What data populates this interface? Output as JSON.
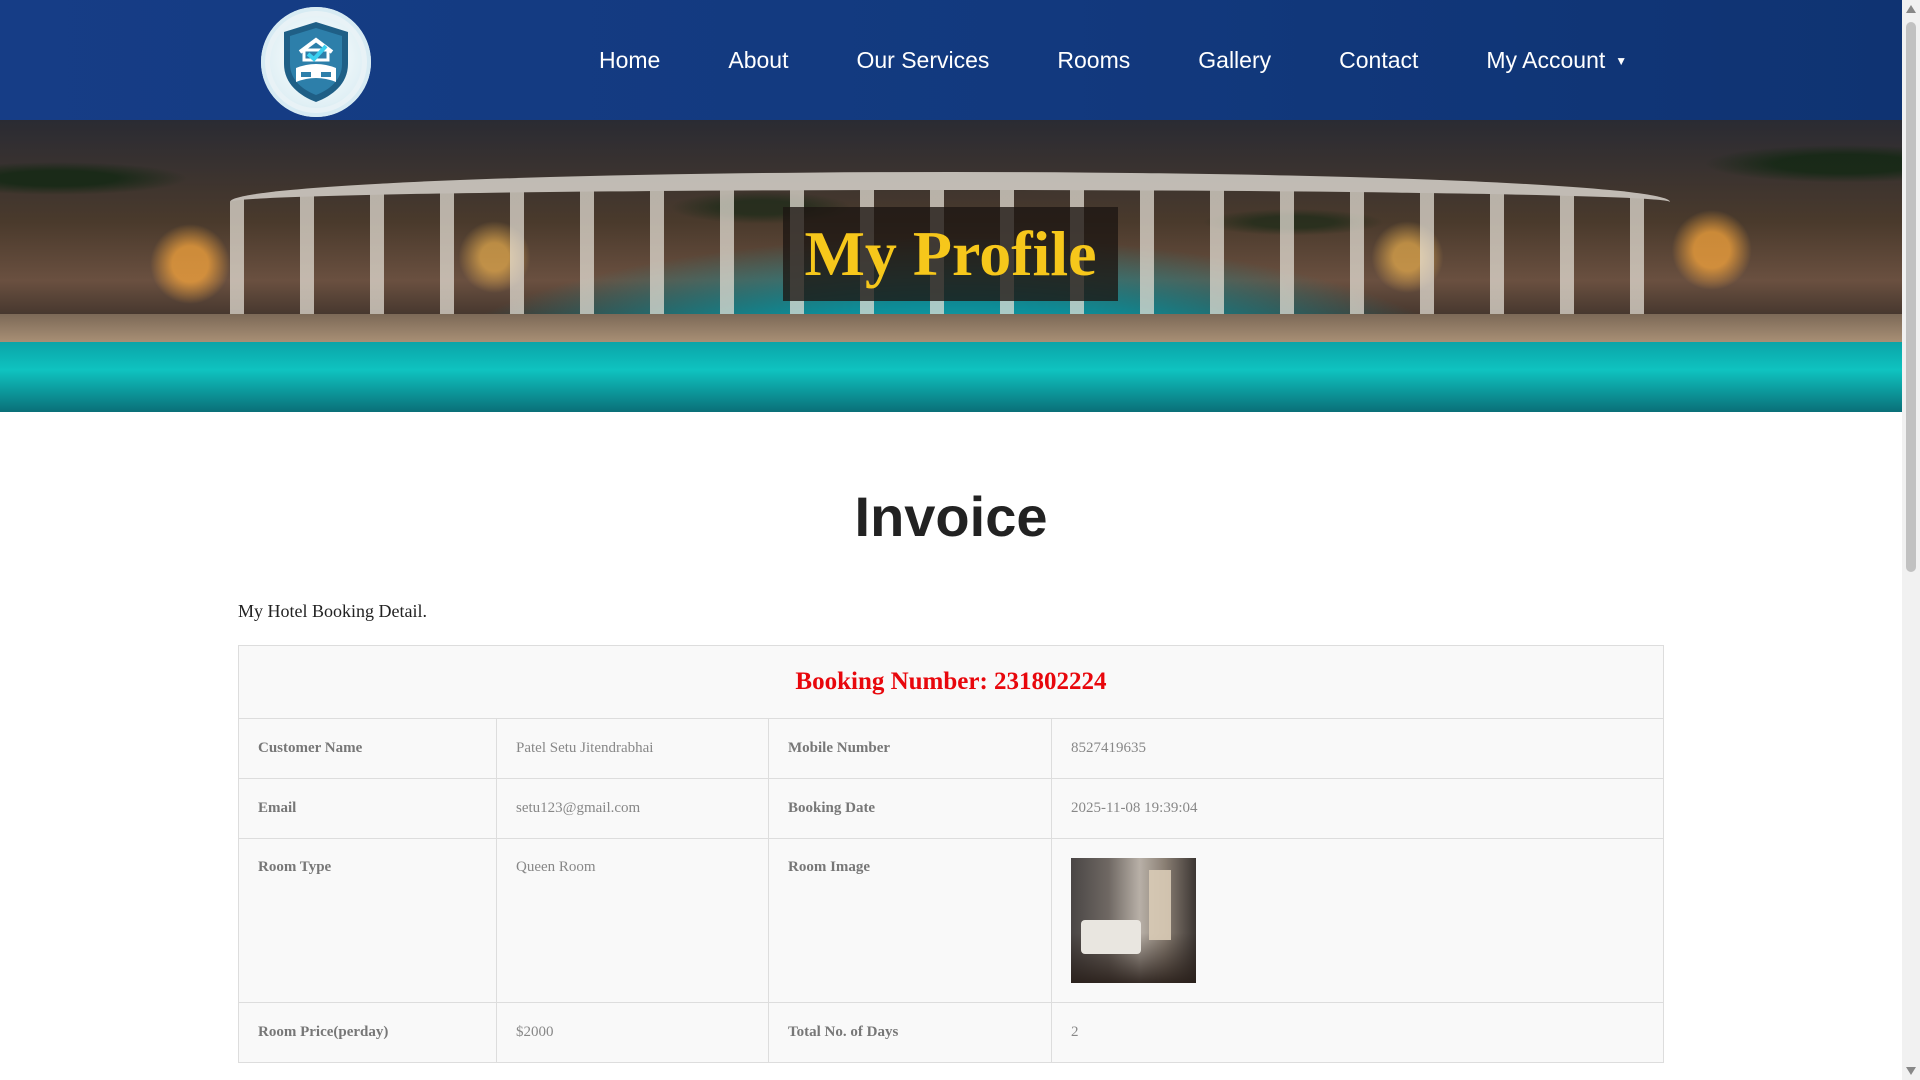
{
  "nav": {
    "items": [
      "Home",
      "About",
      "Our Services",
      "Rooms",
      "Gallery",
      "Contact",
      "My Account"
    ]
  },
  "hero": {
    "title": "My Profile"
  },
  "invoice": {
    "title": "Invoice",
    "subtitle": "My Hotel Booking Detail.",
    "booking_number": "Booking Number: 231802224",
    "rows": [
      {
        "l1": "Customer Name",
        "v1": "Patel Setu Jitendrabhai",
        "l2": "Mobile Number",
        "v2": "8527419635"
      },
      {
        "l1": "Email",
        "v1": "setu123@gmail.com",
        "l2": "Booking Date",
        "v2": "2025-11-08 19:39:04"
      },
      {
        "l1": "Room Type",
        "v1": "Queen Room",
        "l2": "Room Image"
      },
      {
        "l1": "Room Price(perday)",
        "v1": "$2000",
        "l2": "Total No. of Days",
        "v2": "2"
      }
    ]
  },
  "colors": {
    "nav_bg": "#163d86",
    "hero_title": "#f6c71b",
    "booking_number": "#e8070c"
  },
  "icons": [
    "hotel-logo-icon",
    "caret-down-icon",
    "room-image"
  ]
}
